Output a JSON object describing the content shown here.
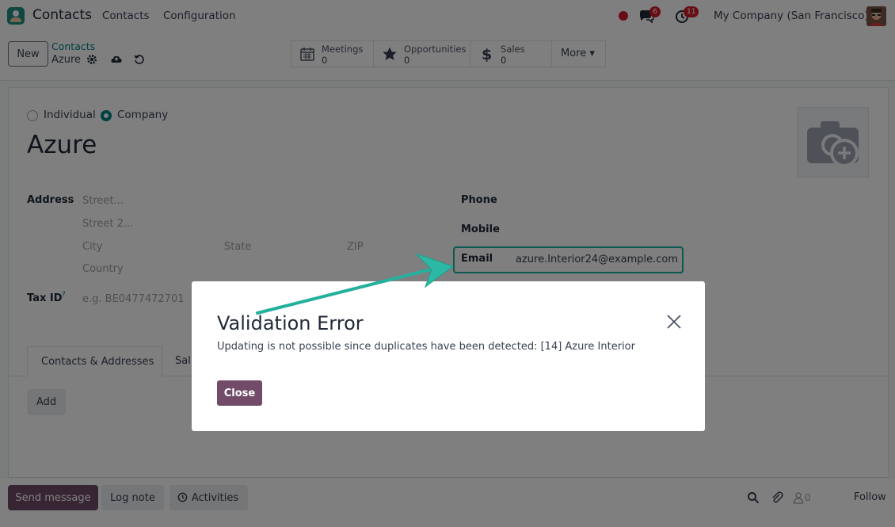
{
  "navbar": {
    "app_title": "Contacts",
    "menu": [
      "Contacts",
      "Configuration"
    ],
    "messages_badge": "6",
    "activities_badge": "11",
    "company": "My Company (San Francisco)"
  },
  "control": {
    "new_label": "New",
    "breadcrumb_parent": "Contacts",
    "breadcrumb_current": "Azure",
    "smart_buttons": [
      {
        "label": "Meetings",
        "value": "0"
      },
      {
        "label": "Opportunities",
        "value": "0"
      },
      {
        "label": "Sales",
        "value": "0"
      }
    ],
    "more_label": "More ▾"
  },
  "form": {
    "type_individual": "Individual",
    "type_company": "Company",
    "selected_type": "Company",
    "name": "Azure",
    "address_label": "Address",
    "street_placeholder": "Street...",
    "street2_placeholder": "Street 2...",
    "city_placeholder": "City",
    "state_placeholder": "State",
    "zip_placeholder": "ZIP",
    "country_placeholder": "Country",
    "tax_label": "Tax ID",
    "tax_help": "?",
    "tax_placeholder": "e.g. BE0477472701",
    "phone_label": "Phone",
    "mobile_label": "Mobile",
    "email_label": "Email",
    "email_value": "azure.Interior24@example.com",
    "tabs": [
      "Contacts & Addresses",
      "Sal"
    ],
    "add_label": "Add"
  },
  "chatter": {
    "send_message": "Send message",
    "log_note": "Log note",
    "activities": "Activities",
    "follower_count": "0",
    "follow": "Follow"
  },
  "dialog": {
    "title": "Validation Error",
    "message": "Updating is not possible since duplicates have been detected: [14] Azure Interior",
    "close_label": "Close"
  },
  "colors": {
    "primary": "#714b67",
    "accent": "#017e84",
    "highlight": "#19b2a0",
    "badge": "#d11b2b"
  }
}
